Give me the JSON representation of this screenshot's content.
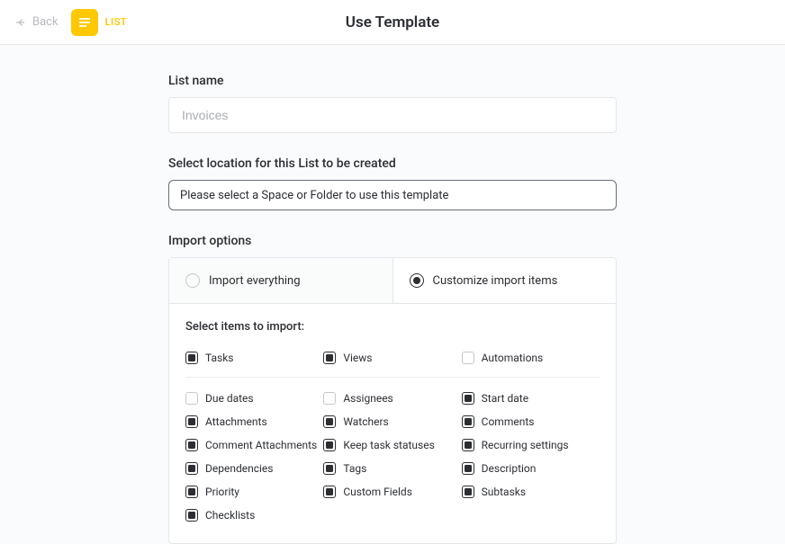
{
  "header": {
    "back_label": "Back",
    "list_label": "LIST",
    "page_title": "Use Template"
  },
  "listName": {
    "label": "List name",
    "placeholder": "Invoices"
  },
  "location": {
    "label": "Select location for this List to be created",
    "placeholder": "Please select a Space or Folder to use this template"
  },
  "importOptions": {
    "label": "Import options",
    "everything_label": "Import everything",
    "customize_label": "Customize import items"
  },
  "importItems": {
    "heading": "Select items to import:",
    "top": [
      {
        "label": "Tasks",
        "checked": true
      },
      {
        "label": "Views",
        "checked": true
      },
      {
        "label": "Automations",
        "checked": false
      }
    ],
    "rows": [
      [
        {
          "label": "Due dates",
          "checked": false
        },
        {
          "label": "Assignees",
          "checked": false
        },
        {
          "label": "Start date",
          "checked": true
        }
      ],
      [
        {
          "label": "Attachments",
          "checked": true
        },
        {
          "label": "Watchers",
          "checked": true
        },
        {
          "label": "Comments",
          "checked": true
        }
      ],
      [
        {
          "label": "Comment Attachments",
          "checked": true
        },
        {
          "label": "Keep task statuses",
          "checked": true
        },
        {
          "label": "Recurring settings",
          "checked": true
        }
      ],
      [
        {
          "label": "Dependencies",
          "checked": true
        },
        {
          "label": "Tags",
          "checked": true
        },
        {
          "label": "Description",
          "checked": true
        }
      ],
      [
        {
          "label": "Priority",
          "checked": true
        },
        {
          "label": "Custom Fields",
          "checked": true
        },
        {
          "label": "Subtasks",
          "checked": true
        }
      ],
      [
        {
          "label": "Checklists",
          "checked": true
        }
      ]
    ]
  }
}
